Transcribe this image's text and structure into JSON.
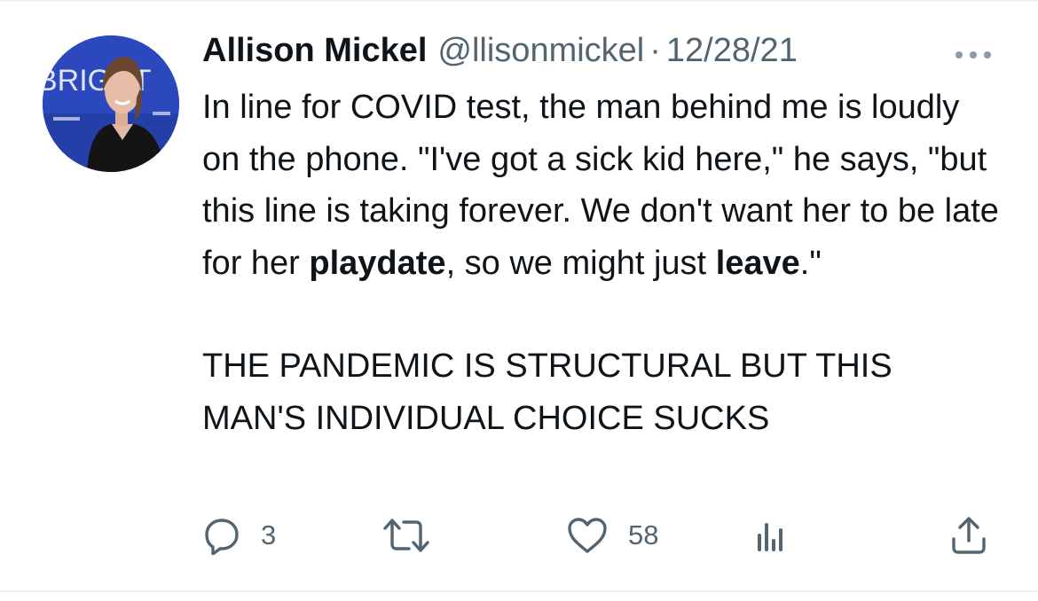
{
  "tweet": {
    "author": {
      "display_name": "Allison Mickel",
      "handle": "@llisonmickel",
      "avatar_icon": "profile-photo",
      "avatar_backdrop_text": "BRIGHT"
    },
    "separator": "·",
    "date": "12/28/21",
    "more_icon": "ellipsis-icon",
    "text": {
      "p1_a": "In line for COVID test, the man behind me is loudly on the phone. \"I've got a sick kid here,\" he says, \"but this line is taking forever. We don't want her to be late for her ",
      "p1_bold_1": "playdate",
      "p1_b": ", so we might just ",
      "p1_bold_2": "leave",
      "p1_c": ".\"",
      "p2": "THE PANDEMIC IS STRUCTURAL BUT THIS MAN'S INDIVIDUAL CHOICE SUCKS"
    },
    "actions": {
      "reply": {
        "icon": "reply-icon",
        "count": "3"
      },
      "retweet": {
        "icon": "retweet-icon",
        "count": ""
      },
      "like": {
        "icon": "heart-icon",
        "count": "58"
      },
      "views": {
        "icon": "analytics-icon"
      },
      "share": {
        "icon": "share-icon"
      }
    },
    "colors": {
      "text": "#0f1419",
      "secondary": "#536471",
      "avatar_bg": "#2a47b8"
    }
  }
}
